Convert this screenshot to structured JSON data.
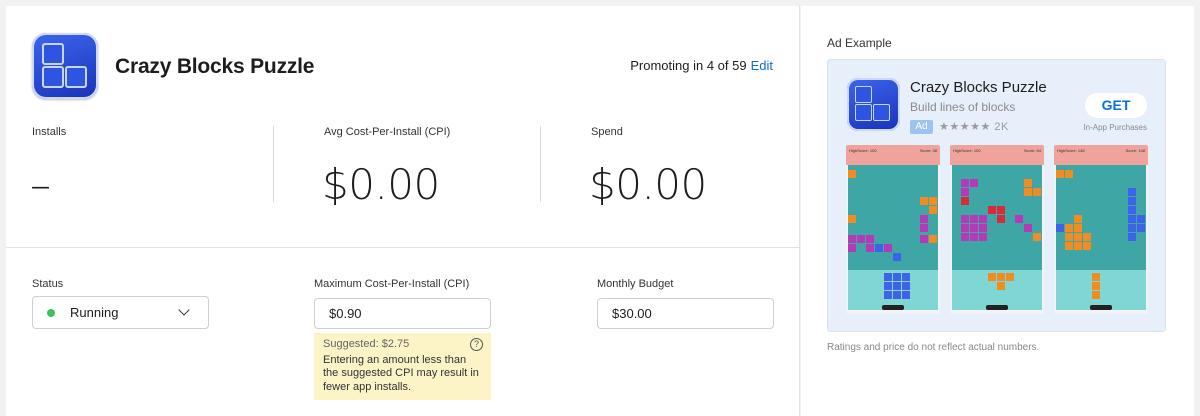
{
  "app": {
    "title": "Crazy Blocks Puzzle",
    "icon": "app-blocks-icon",
    "brand_color": "#2e55e2"
  },
  "promo": {
    "text": "Promoting in 4 of 59",
    "edit_label": "Edit"
  },
  "metrics": [
    {
      "label": "Installs",
      "value": "–"
    },
    {
      "label": "Avg Cost-Per-Install (CPI)",
      "value": "$0.00"
    },
    {
      "label": "Spend",
      "value": "$0.00"
    }
  ],
  "status": {
    "label": "Status",
    "value": "Running",
    "color": "#3cc35a"
  },
  "max_cpi": {
    "label": "Maximum Cost-Per-Install (CPI)",
    "value": "$0.90",
    "suggested": "Suggested: $2.75",
    "hint": "Entering an amount less than the suggested CPI may result in fewer app installs."
  },
  "budget": {
    "label": "Monthly Budget",
    "value": "$30.00"
  },
  "ad_example": {
    "title": "Ad Example",
    "app_name": "Crazy Blocks Puzzle",
    "subtitle": "Build lines of blocks",
    "badge": "Ad",
    "stars": "★★★★★",
    "rating_count": "2K",
    "get_label": "GET",
    "iap_label": "In-App Purchases",
    "screenshots": [
      {
        "highscore": "HighScore: 100",
        "score": "Score: 38"
      },
      {
        "highscore": "HighScore: 100",
        "score": "Score: 84"
      },
      {
        "highscore": "HighScore: 148",
        "score": "Score: 148"
      }
    ],
    "note": "Ratings and price do not reflect actual numbers."
  }
}
